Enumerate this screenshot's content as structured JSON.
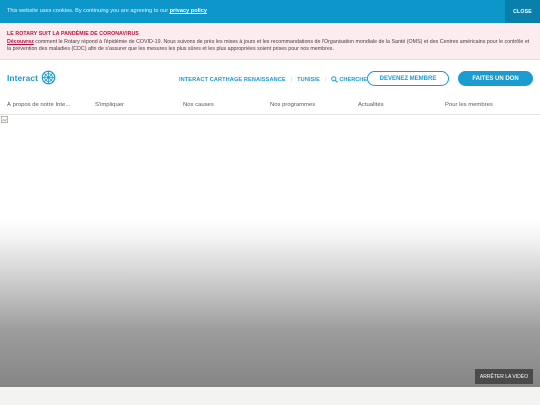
{
  "cookie": {
    "text": "This website uses cookies. By continuing you are agreeing to our",
    "link": "privacy policy",
    "close": "CLOSE"
  },
  "alert": {
    "title": "LE ROTARY SUIT LA PANDÉMIE DE CORONAVIRUS",
    "link": "Découvrez",
    "body": " comment le Rotary répond à l'épidémie de COVID-19. Nous suivons de près les mises à jours et les recommandations de l'Organisation mondiale de la Santé (OMS) et des Centres américains pour le contrôle et la prévention des maladies (CDC) afin de s'assurer que les mesures les plus sûres et les plus appropriées soient prises pour nos membres."
  },
  "header": {
    "logo_text": "Interact",
    "club": "INTERACT CARTHAGE RENAISSANCE",
    "country": "TUNISIE",
    "search": "CHERCHER",
    "member_button": "DEVENEZ MEMBRE",
    "donate_button": "FAITES UN DON"
  },
  "nav": {
    "items": [
      "À propos de notre Inte...",
      "S'impliquer",
      "Nos causes",
      "Nos programmes",
      "Actualités",
      "Pour les membres"
    ]
  },
  "hero": {
    "stop_video": "ARRÊTER LA VIDÉO"
  },
  "colors": {
    "accent": "#1a9bd1",
    "cookie_bg": "#0c96c9",
    "alert_bg": "#fcecef",
    "alert_accent": "#b5123c"
  }
}
